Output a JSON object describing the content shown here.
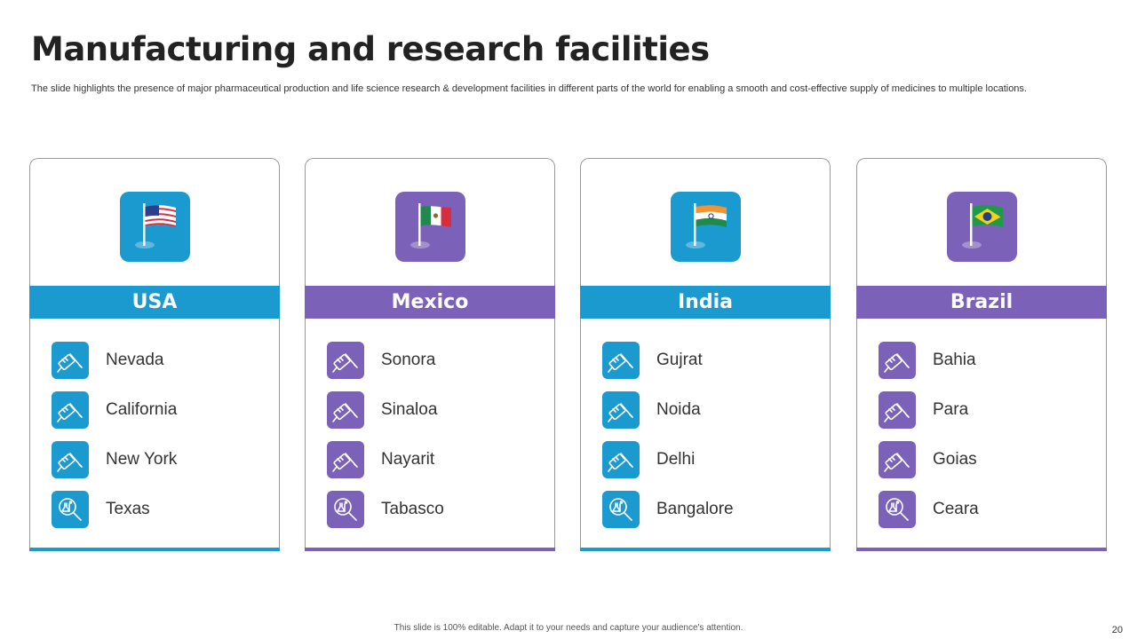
{
  "title": "Manufacturing and research facilities",
  "subtitle": "The slide highlights the presence of major pharmaceutical production and life science research & development facilities in different parts of the world for  enabling a smooth and cost-effective supply of medicines to multiple locations.",
  "colors": {
    "blue": "#1b9ad0",
    "purple": "#7b61b8"
  },
  "cards": [
    {
      "country": "USA",
      "flag_icon": "usa-flag-icon",
      "color": "#1b9ad0",
      "items": [
        {
          "label": "Nevada",
          "icon": "manufacturing-icon"
        },
        {
          "label": "California",
          "icon": "manufacturing-icon"
        },
        {
          "label": "New York",
          "icon": "manufacturing-icon"
        },
        {
          "label": "Texas",
          "icon": "research-icon"
        }
      ]
    },
    {
      "country": "Mexico",
      "flag_icon": "mexico-flag-icon",
      "color": "#7b61b8",
      "items": [
        {
          "label": "Sonora",
          "icon": "manufacturing-icon"
        },
        {
          "label": "Sinaloa",
          "icon": "manufacturing-icon"
        },
        {
          "label": "Nayarit",
          "icon": "manufacturing-icon"
        },
        {
          "label": "Tabasco",
          "icon": "research-icon"
        }
      ]
    },
    {
      "country": "India",
      "flag_icon": "india-flag-icon",
      "color": "#1b9ad0",
      "items": [
        {
          "label": "Gujrat",
          "icon": "manufacturing-icon"
        },
        {
          "label": "Noida",
          "icon": "manufacturing-icon"
        },
        {
          "label": "Delhi",
          "icon": "manufacturing-icon"
        },
        {
          "label": "Bangalore",
          "icon": "research-icon"
        }
      ]
    },
    {
      "country": "Brazil",
      "flag_icon": "brazil-flag-icon",
      "color": "#7b61b8",
      "items": [
        {
          "label": "Bahia",
          "icon": "manufacturing-icon"
        },
        {
          "label": "Para",
          "icon": "manufacturing-icon"
        },
        {
          "label": "Goias",
          "icon": "manufacturing-icon"
        },
        {
          "label": "Ceara",
          "icon": "research-icon"
        }
      ]
    }
  ],
  "footer": "This slide is 100% editable. Adapt it to your needs and capture your audience's attention.",
  "page_number": "20"
}
